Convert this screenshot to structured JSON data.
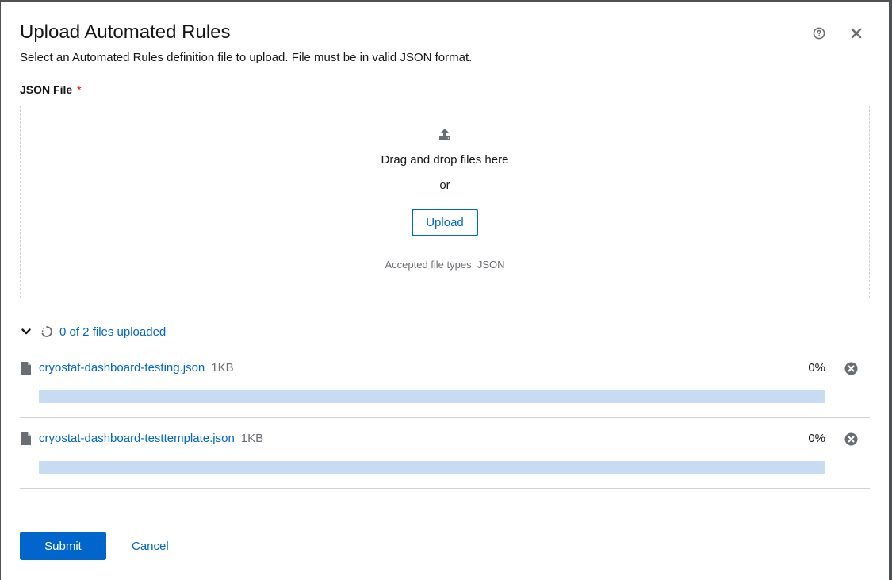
{
  "modal": {
    "title": "Upload Automated Rules",
    "description": "Select an Automated Rules definition file to upload. File must be in valid JSON format.",
    "help_icon": "help-circle-icon",
    "close_icon": "close-icon"
  },
  "form": {
    "field_label": "JSON File",
    "required_marker": "*"
  },
  "dropzone": {
    "icon": "upload-icon",
    "title": "Drag and drop files here",
    "separator": "or",
    "upload_button": "Upload",
    "accepted_types": "Accepted file types: JSON"
  },
  "upload_status": {
    "expanded": true,
    "text": "0 of 2 files uploaded"
  },
  "files": [
    {
      "name": "cryostat-dashboard-testing.json",
      "size": "1KB",
      "progress_label": "0%",
      "progress": 0
    },
    {
      "name": "cryostat-dashboard-testtemplate.json",
      "size": "1KB",
      "progress_label": "0%",
      "progress": 0
    }
  ],
  "actions": {
    "submit": "Submit",
    "cancel": "Cancel"
  },
  "colors": {
    "primary": "#0066cc",
    "progress_track": "#c7dcf2",
    "required": "#c9190b"
  }
}
